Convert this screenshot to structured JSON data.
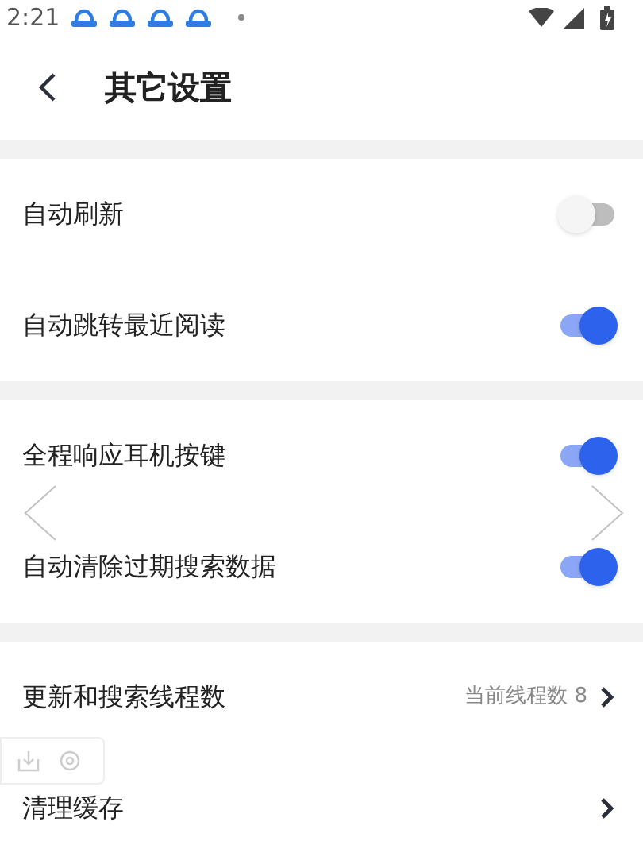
{
  "status_bar": {
    "time": "2:21"
  },
  "header": {
    "title": "其它设置"
  },
  "sections": [
    {
      "rows": [
        {
          "kind": "toggle",
          "label": "自动刷新",
          "on": false
        },
        {
          "kind": "toggle",
          "label": "自动跳转最近阅读",
          "on": true
        }
      ]
    },
    {
      "rows": [
        {
          "kind": "toggle",
          "label": "全程响应耳机按键",
          "on": true
        },
        {
          "kind": "toggle",
          "label": "自动清除过期搜索数据",
          "on": true
        }
      ]
    },
    {
      "rows": [
        {
          "kind": "link",
          "label": "更新和搜索线程数",
          "value": "当前线程数 8"
        },
        {
          "kind": "link",
          "label": "清理缓存"
        }
      ]
    }
  ]
}
